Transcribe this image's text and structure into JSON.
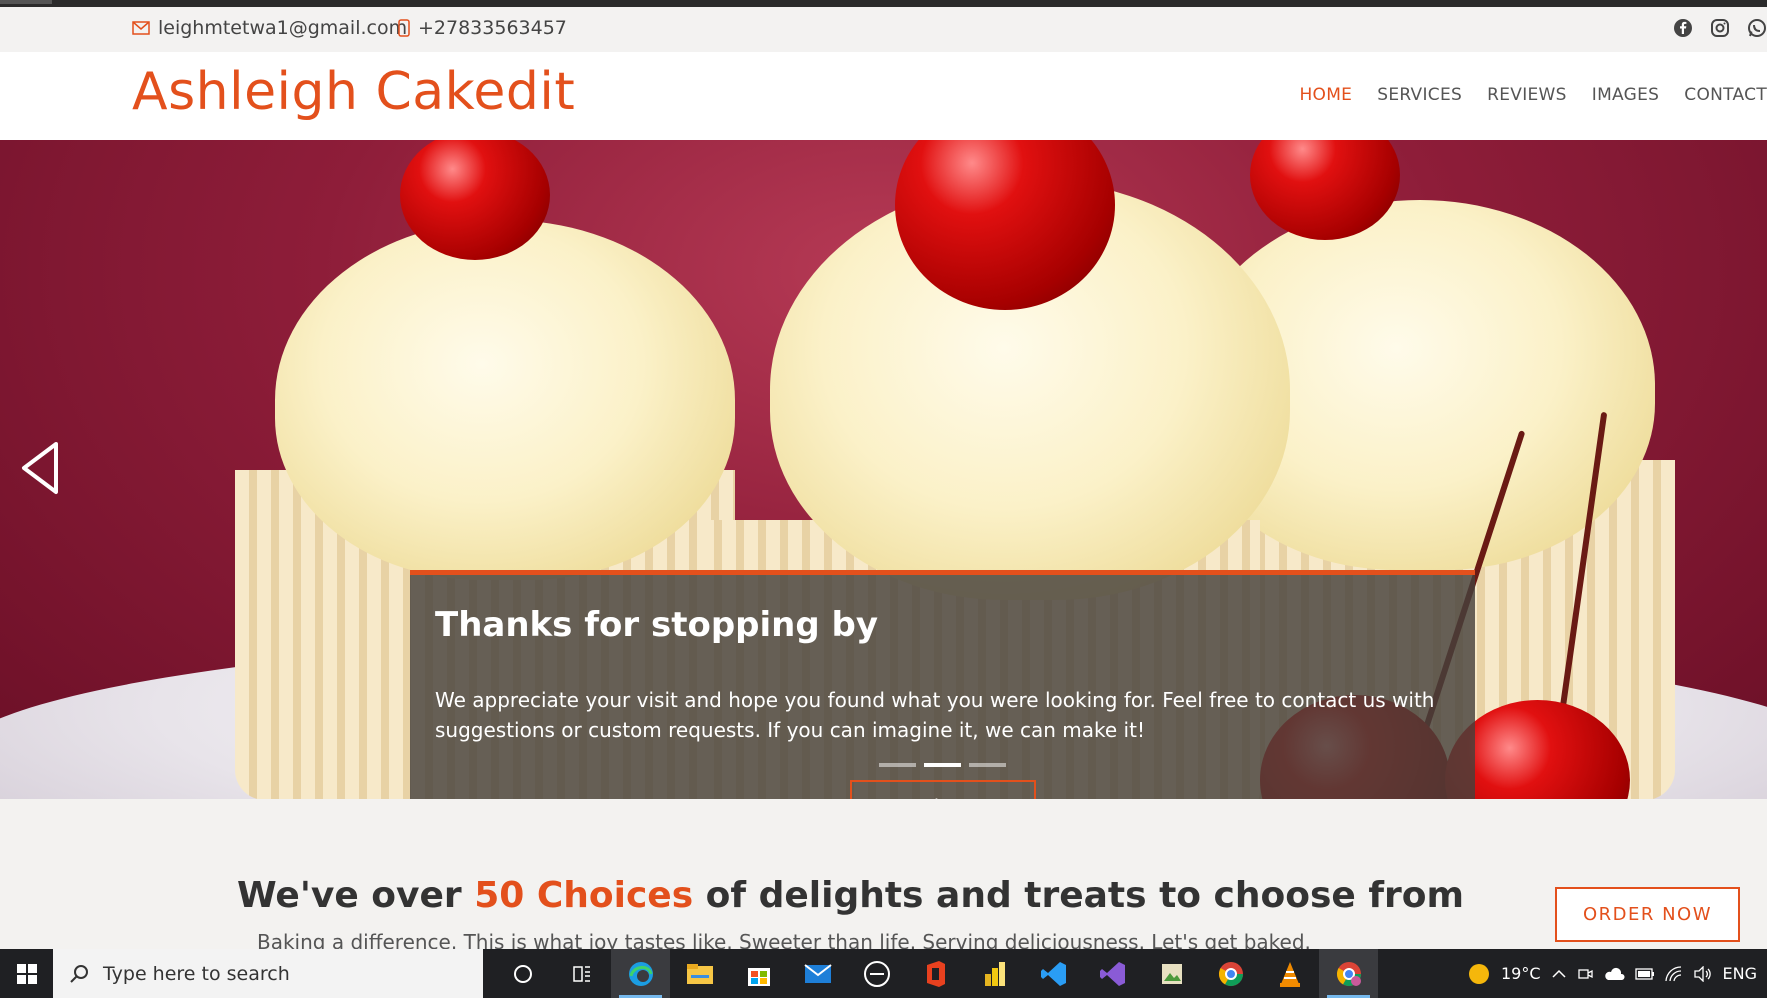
{
  "contact": {
    "email": "leighmtetwa1@gmail.com",
    "phone": "+27833563457"
  },
  "social": [
    "facebook-icon",
    "instagram-icon",
    "whatsapp-icon"
  ],
  "brand": "Ashleigh Cakedit",
  "nav": {
    "items": [
      "HOME",
      "SERVICES",
      "REVIEWS",
      "IMAGES",
      "CONTACT"
    ],
    "active": "HOME"
  },
  "hero": {
    "title": "Thanks for stopping by",
    "text": "We appreciate your visit and hope you found what you were looking for. Feel free to contact us with suggestions or custom requests. If you can imagine it, we can make it!",
    "button": "Read More",
    "slides": 3,
    "active_slide": 2
  },
  "intro": {
    "heading_pre": "We've over ",
    "heading_highlight": "50 Choices",
    "heading_post": " of delights and treats to choose from",
    "subtext": "Baking a difference. This is what joy tastes like. Sweeter than life. Serving deliciousness. Let's get baked.",
    "order_button": "ORDER NOW"
  },
  "taskbar": {
    "search_placeholder": "Type here to search",
    "temperature": "19°C",
    "language": "ENG"
  },
  "colors": {
    "accent": "#e3501c"
  }
}
